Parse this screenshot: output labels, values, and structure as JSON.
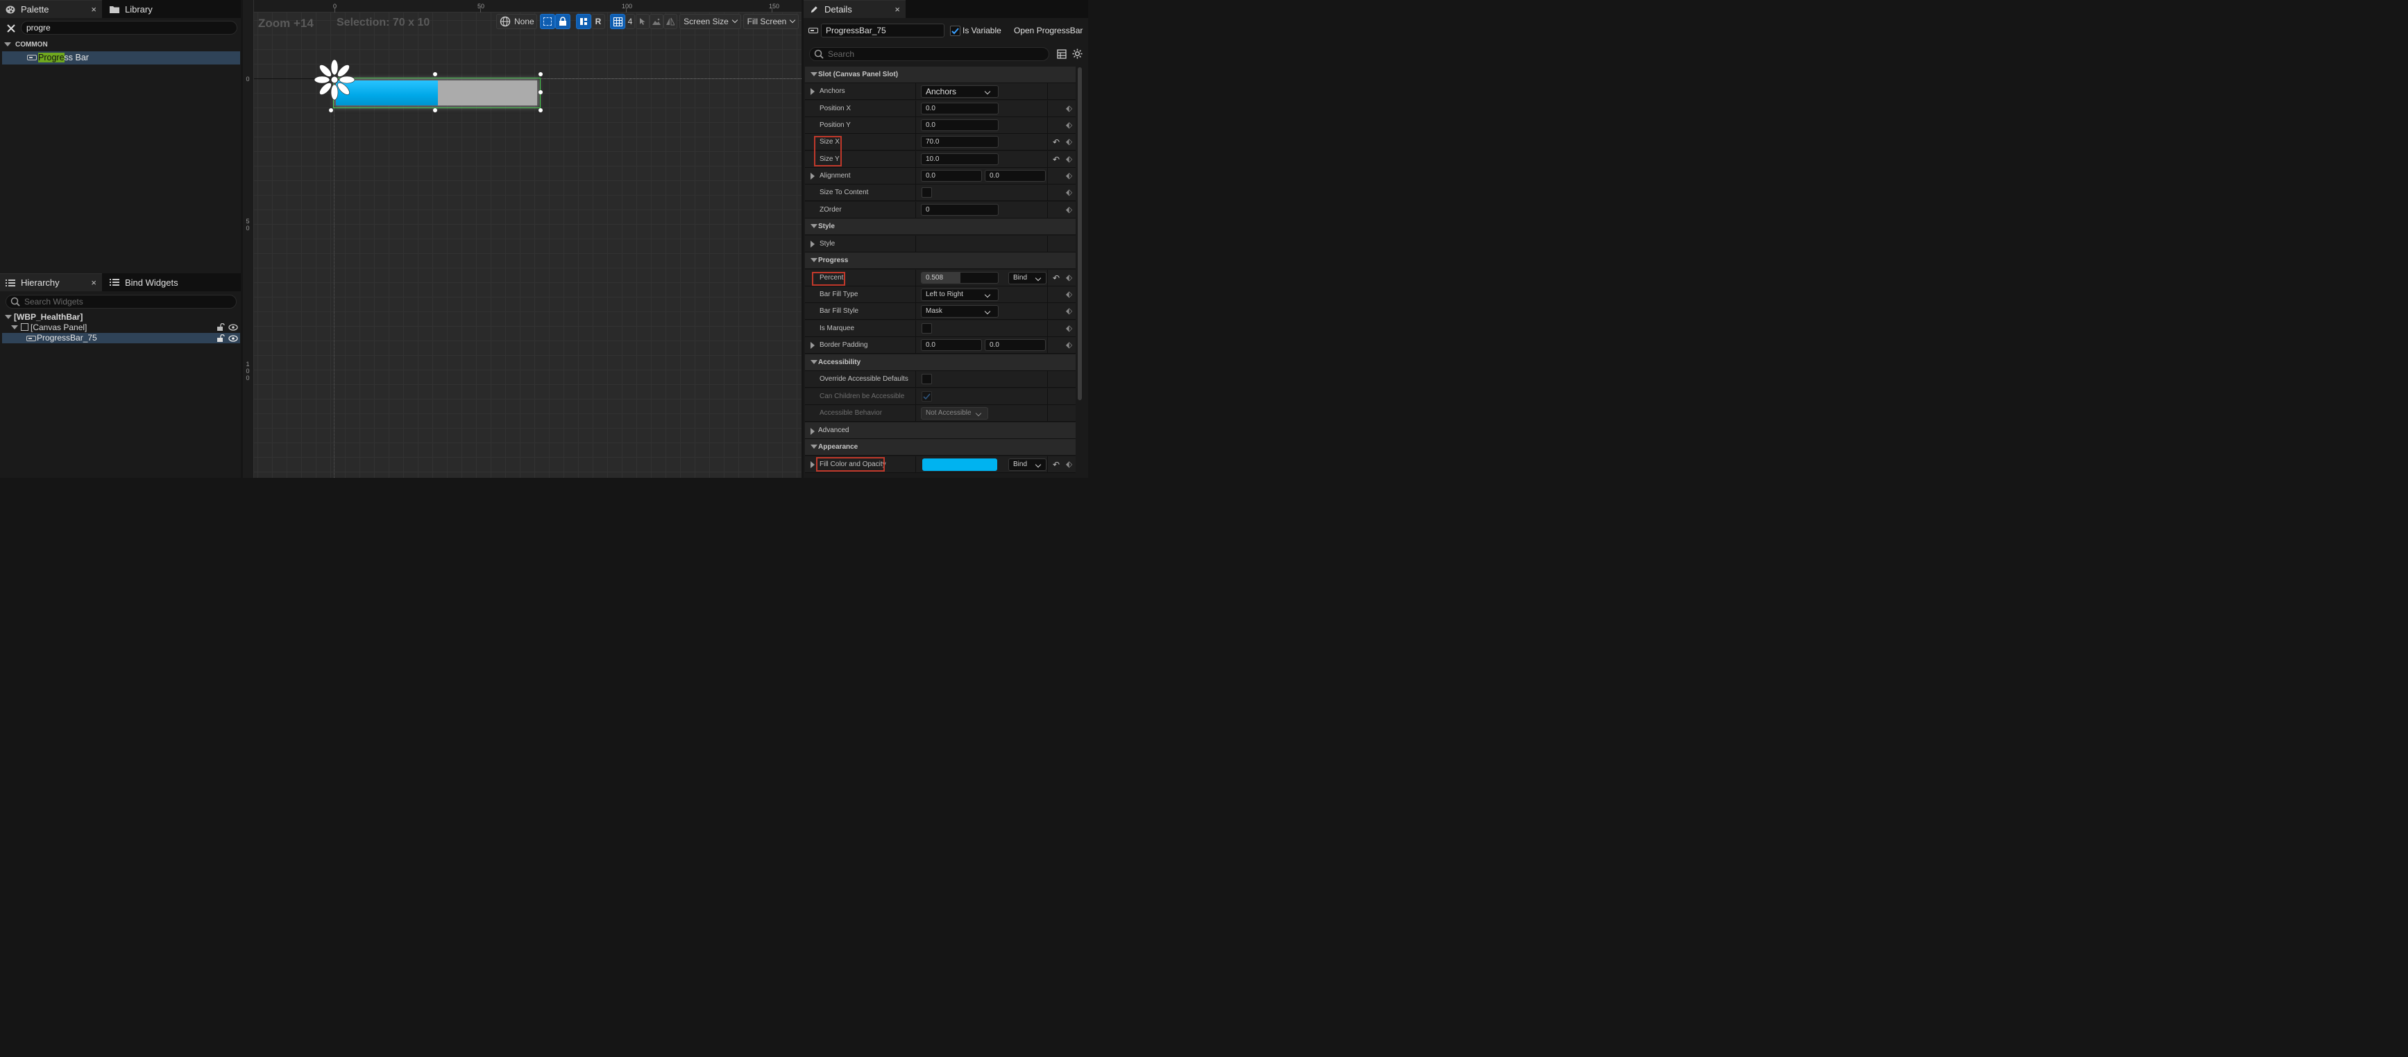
{
  "palette": {
    "tab_label": "Palette",
    "close": "×",
    "library_tab_label": "Library",
    "search_value": "progre",
    "section_common": "COMMON",
    "item_highlight": "Progre",
    "item_rest": "ss Bar"
  },
  "hierarchy": {
    "tab_label": "Hierarchy",
    "close": "×",
    "bind_tab_label": "Bind Widgets",
    "search_placeholder": "Search Widgets",
    "root": "[WBP_HealthBar]",
    "canvas": "[Canvas Panel]",
    "progressbar": "ProgressBar_75"
  },
  "viewport": {
    "zoom": "Zoom +14",
    "selection": "Selection: 70 x 10",
    "ruler_top": [
      "0",
      "50",
      "100",
      "150"
    ],
    "ruler_left": [
      "0",
      "5\n0",
      "1\n0\n0"
    ],
    "toolbar": {
      "none_label": "None",
      "r_label": "R",
      "grid_count": "4",
      "screen_size": "Screen Size",
      "fill_screen": "Fill Screen"
    },
    "progress_percent": 0.508,
    "fill_color": "#00a8e8"
  },
  "details": {
    "tab_label": "Details",
    "close": "×",
    "name_value": "ProgressBar_75",
    "is_variable_label": "Is Variable",
    "is_variable_checked": true,
    "open_link": "Open ProgressBar",
    "search_placeholder": "Search",
    "sections": {
      "slot": "Slot (Canvas Panel Slot)",
      "style": "Style",
      "progress": "Progress",
      "accessibility": "Accessibility",
      "advanced": "Advanced",
      "appearance": "Appearance"
    },
    "props": {
      "anchors_label": "Anchors",
      "anchors_value": "Anchors",
      "position_x_label": "Position X",
      "position_x": "0.0",
      "position_y_label": "Position Y",
      "position_y": "0.0",
      "size_x_label": "Size X",
      "size_x": "70.0",
      "size_y_label": "Size Y",
      "size_y": "10.0",
      "alignment_label": "Alignment",
      "alignment_x": "0.0",
      "alignment_y": "0.0",
      "size_to_content_label": "Size To Content",
      "zorder_label": "ZOrder",
      "zorder": "0",
      "style_label": "Style",
      "percent_label": "Percent",
      "percent": "0.508",
      "bind_label": "Bind",
      "bar_fill_type_label": "Bar Fill Type",
      "bar_fill_type": "Left to Right",
      "bar_fill_style_label": "Bar Fill Style",
      "bar_fill_style": "Mask",
      "is_marquee_label": "Is Marquee",
      "border_padding_label": "Border Padding",
      "border_padding_x": "0.0",
      "border_padding_y": "0.0",
      "override_accessible_label": "Override Accessible Defaults",
      "can_children_label": "Can Children be Accessible",
      "accessible_behavior_label": "Accessible Behavior",
      "accessible_behavior": "Not Accessible",
      "fill_color_label": "Fill Color and Opacity",
      "fill_bind_label": "Bind",
      "fill_color": "#00b3f0"
    }
  }
}
